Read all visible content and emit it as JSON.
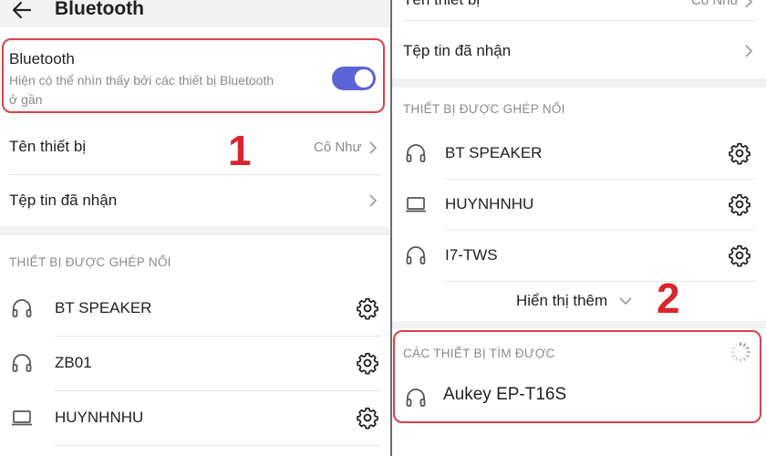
{
  "left": {
    "header": {
      "title": "Bluetooth"
    },
    "bluetooth": {
      "title": "Bluetooth",
      "subtitle_line1": "Hiện có thể nhìn thấy bởi các thiết bị Bluetooth",
      "subtitle_line2": "ở gần",
      "toggle_on": true
    },
    "device_name_row": {
      "label": "Tên thiết bị",
      "value": "Cô Như"
    },
    "received_files_row": {
      "label": "Tệp tin đã nhận"
    },
    "paired_section": {
      "label": "THIẾT BỊ ĐƯỢC GHÉP NỐI",
      "devices": [
        {
          "name": "BT SPEAKER",
          "icon": "headphones-icon"
        },
        {
          "name": "ZB01",
          "icon": "headphones-icon"
        },
        {
          "name": "HUYNHNHU",
          "icon": "laptop-icon"
        }
      ]
    },
    "step_label": "1"
  },
  "right": {
    "top_partial": {
      "label": "Tên thiết bị",
      "value": "Cô Như"
    },
    "received_files_row": {
      "label": "Tệp tin đã nhận"
    },
    "paired_section": {
      "label": "THIẾT BỊ ĐƯỢC GHÉP NỐI",
      "devices": [
        {
          "name": "BT SPEAKER",
          "icon": "headphones-icon"
        },
        {
          "name": "HUYNHNHU",
          "icon": "laptop-icon"
        },
        {
          "name": "I7-TWS",
          "icon": "headphones-icon"
        }
      ],
      "show_more": "Hiển thị thêm"
    },
    "found_section": {
      "label": "CÁC THIẾT BỊ TÌM ĐƯỢC",
      "devices": [
        {
          "name": "Aukey EP-T16S",
          "icon": "headphones-icon"
        }
      ]
    },
    "step_label": "2"
  },
  "colors": {
    "highlight": "#d9414a",
    "toggle": "#5c63d6",
    "step_number": "#d9252f"
  }
}
